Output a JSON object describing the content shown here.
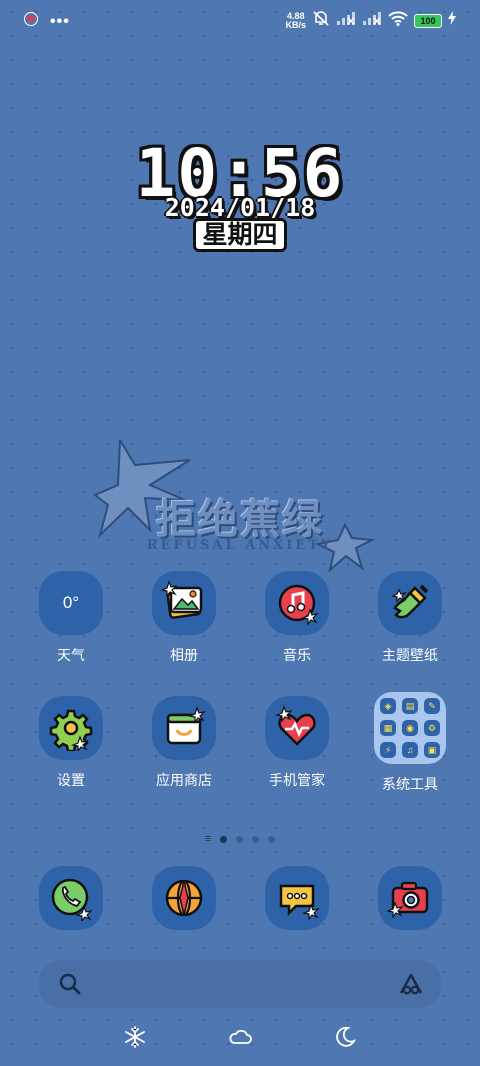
{
  "status_bar": {
    "left_icons": [
      "heart-notification-icon"
    ],
    "more_dots": "•••",
    "net_speed_value": "4.88",
    "net_speed_unit": "KB/s",
    "battery": "100",
    "icons": [
      "mute-icon",
      "signal-icon",
      "signal-icon",
      "wifi-icon",
      "battery-icon",
      "charging-icon"
    ]
  },
  "clock": {
    "time": "10:56",
    "date": "2024/01/18",
    "weekday": "星期四"
  },
  "wallpaper_slogan": {
    "chinese": "拒绝蕉绿",
    "english": "REFUSAL ANXIETY"
  },
  "apps": {
    "weather": {
      "label": "天气",
      "value": "0°"
    },
    "gallery": {
      "label": "相册"
    },
    "music": {
      "label": "音乐"
    },
    "themes": {
      "label": "主题壁纸"
    },
    "settings": {
      "label": "设置"
    },
    "app_store": {
      "label": "应用商店"
    },
    "phone_manager": {
      "label": "手机管家"
    },
    "tools_folder": {
      "label": "系统工具"
    }
  },
  "pager": {
    "lines_glyph": "≡",
    "pages": 4,
    "active_page": 1
  },
  "dock": [
    "phone-icon",
    "browser-icon",
    "messages-icon",
    "camera-icon"
  ],
  "search_bar": {
    "icons": [
      "search-icon",
      "assistant-icon"
    ]
  },
  "bottom_icons": [
    "snowflake-icon",
    "cloud-icon",
    "moon-icon"
  ],
  "colors": {
    "background": "#4f78b3",
    "icon_tile": "#2f63a9",
    "folder_tile": "#a8c6ee",
    "battery_green": "#34c759"
  }
}
